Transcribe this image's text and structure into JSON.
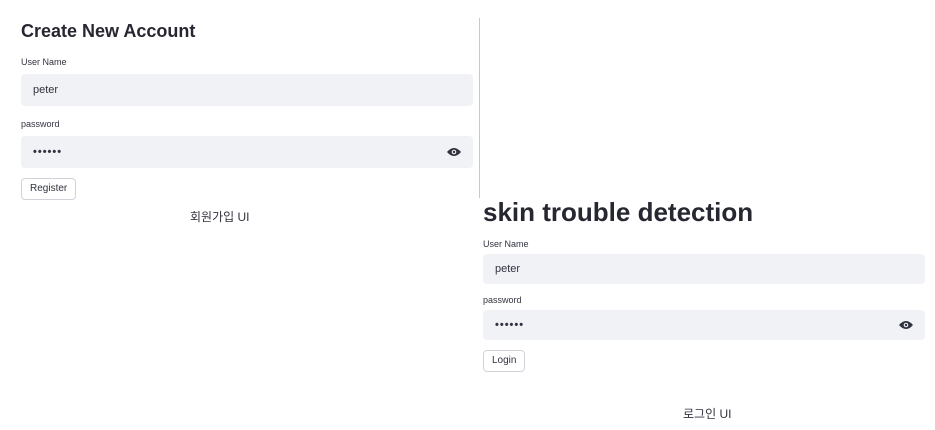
{
  "register": {
    "title": "Create New Account",
    "username_label": "User Name",
    "username_value": "peter",
    "password_label": "password",
    "password_value": "••••••",
    "button_label": "Register",
    "caption": "회원가입 UI"
  },
  "login": {
    "title": "skin trouble detection",
    "username_label": "User Name",
    "username_value": "peter",
    "password_label": "password",
    "password_value": "••••••",
    "button_label": "Login",
    "caption": "로그인 UI"
  },
  "icons": {
    "password_toggle": "eye-icon"
  },
  "colors": {
    "field_bg": "#f0f2f6",
    "text": "#31333f",
    "title": "#262730"
  }
}
